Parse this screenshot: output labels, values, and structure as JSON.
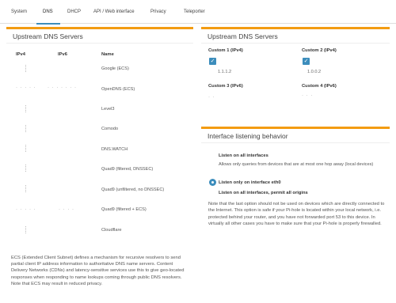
{
  "tabs": [
    "System",
    "DNS",
    "DHCP",
    "API / Web interface",
    "Privacy",
    "Teleporter"
  ],
  "active_tab": "DNS",
  "upstream_servers": {
    "title": "Upstream DNS Servers",
    "col_ipv4": "IPv4",
    "col_ipv6": "IPv6",
    "col_name": "Name",
    "providers": [
      "Google (ECS)",
      "OpenDNS (ECS)",
      "Level3",
      "Comodo",
      "DNS.WATCH",
      "Quad9 (filtered, DNSSEC)",
      "Quad9 (unfiltered, no DNSSEC)",
      "Quad9 (filtered + ECS)",
      "Cloudflare"
    ],
    "ecs_note": "ECS (Extended Client Subnet) defines a mechanism for recursive resolvers to send partial client IP address information to authoritative DNS name servers. Content Delivery Networks (CDNs) and latency-sensitive services use this to give geo-located responses when responding to name lookups coming through public DNS resolvers. Note that ECS may result in reduced privacy."
  },
  "custom_servers": {
    "title": "Upstream DNS Servers",
    "custom1_label": "Custom 1 (IPv4)",
    "custom1_value": "1.1.1.2",
    "custom2_label": "Custom 2 (IPv4)",
    "custom2_value": "1.0.0.2",
    "custom3_label": "Custom 3 (IPv6)",
    "custom4_label": "Custom 4 (IPv6)"
  },
  "interface": {
    "title": "Interface listening behavior",
    "opt1_title": "Listen on all interfaces",
    "opt1_desc": "Allows only queries from devices that are at most one hop away (local devices)",
    "opt2_title": "Listen only on interface eth0",
    "opt3_title": "Listen on all interfaces, permit all origins",
    "note": "Note that the last option should not be used on devices which are directly connected to the Internet. This option is safe if your Pi-hole is located within your local network, i.e. protected behind your router, and you have not forwarded port 53 to this device. In virtually all other cases you have to make sure that your Pi-hole is properly firewalled."
  },
  "colors": {
    "accent": "#3c8dbc",
    "box_border": "#f39c12"
  }
}
